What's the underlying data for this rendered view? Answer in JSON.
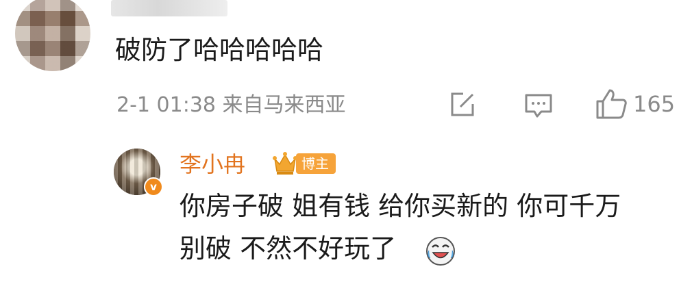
{
  "comment": {
    "text": "破防了哈哈哈哈哈",
    "meta": "2-1 01:38 来自马来西亚",
    "like_count": "165",
    "icons": {
      "share": "share-icon",
      "comment": "comment-icon",
      "like": "thumbs-up-icon"
    }
  },
  "reply": {
    "author": "李小冉",
    "badge_label": "博主",
    "verified_mark": "v",
    "line1": "你房子破 姐有钱 给你买新的 你可千万",
    "line2": "别破 不然不好玩了",
    "emoji": "laughing-tears-emoji",
    "colors": {
      "name": "#e2741f",
      "badge": "#f6a33a"
    }
  }
}
